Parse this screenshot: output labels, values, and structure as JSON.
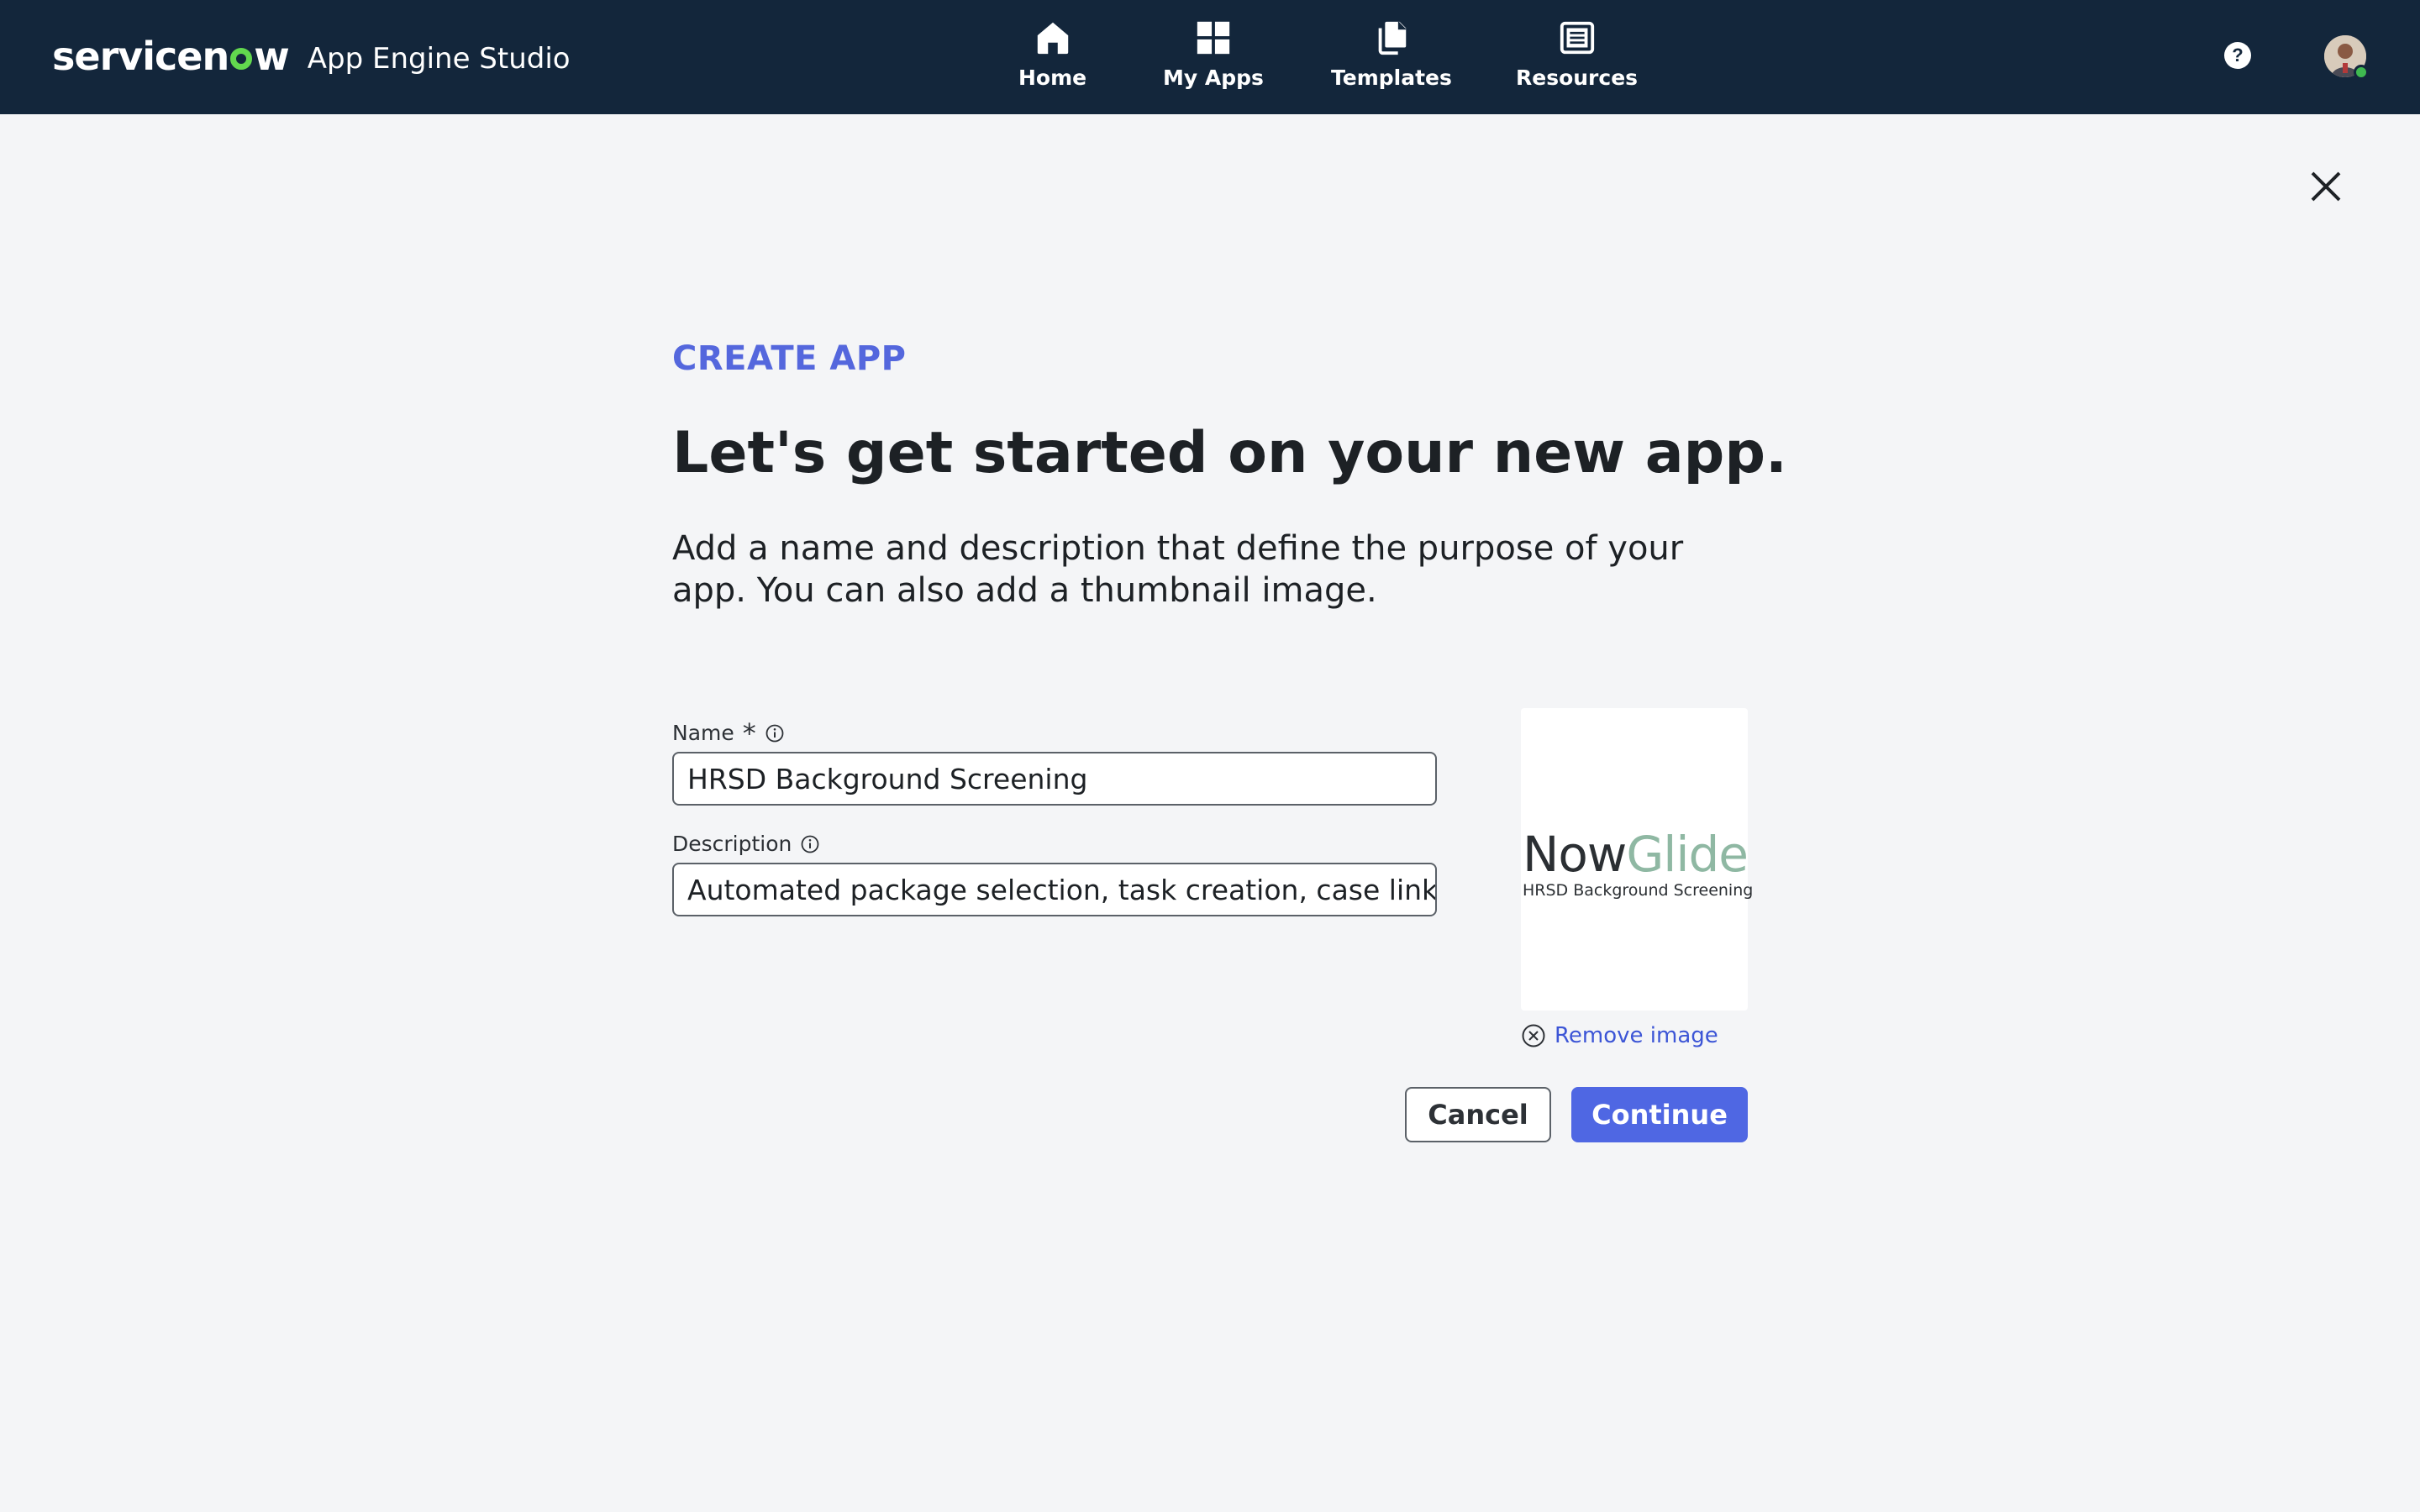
{
  "header": {
    "brand": "servicenow",
    "app_title": "App Engine Studio",
    "nav": [
      {
        "label": "Home",
        "icon": "home-icon"
      },
      {
        "label": "My Apps",
        "icon": "grid-icon"
      },
      {
        "label": "Templates",
        "icon": "templates-icon"
      },
      {
        "label": "Resources",
        "icon": "resources-icon"
      }
    ],
    "help_symbol": "?",
    "colors": {
      "bar": "#13263b",
      "logo_accent": "#62d84e"
    }
  },
  "dialog": {
    "eyebrow": "CREATE APP",
    "headline": "Let's get started on your new app.",
    "lead": "Add a name and description that define the purpose of your app. You can also add a thumbnail image.",
    "name_label": "Name",
    "name_required_symbol": "*",
    "name_value": "HRSD Background Screening",
    "description_label": "Description",
    "description_value": "Automated package selection, task creation, case linking,...",
    "thumbnail": {
      "logo_part1": "Now",
      "logo_part2": "Glide",
      "subtitle": "HRSD Background Screening"
    },
    "remove_image_label": "Remove image",
    "cancel_label": "Cancel",
    "continue_label": "Continue",
    "colors": {
      "accent": "#4f67e3",
      "eyebrow": "#5467dd",
      "link": "#3c55d6"
    }
  }
}
